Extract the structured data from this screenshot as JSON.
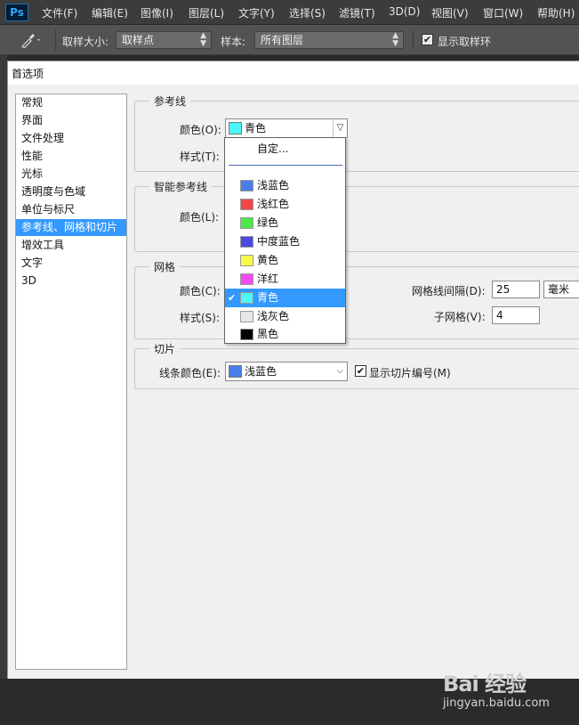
{
  "menubar": {
    "logo": "Ps",
    "items": [
      "文件(F)",
      "编辑(E)",
      "图像(I)",
      "图层(L)",
      "文字(Y)",
      "选择(S)",
      "滤镜(T)",
      "3D(D)",
      "视图(V)",
      "窗口(W)",
      "帮助(H)"
    ]
  },
  "optionsbar": {
    "sample_size_label": "取样大小:",
    "sample_size_value": "取样点",
    "sample_label": "样本:",
    "sample_value": "所有图层",
    "show_ring_label": "显示取样环",
    "show_ring_checked": true
  },
  "dialog": {
    "title": "首选项",
    "categories": [
      "常规",
      "界面",
      "文件处理",
      "性能",
      "光标",
      "透明度与色域",
      "单位与标尺",
      "参考线、网格和切片",
      "增效工具",
      "文字",
      "3D"
    ],
    "selected_category": "参考线、网格和切片",
    "guides": {
      "legend": "参考线",
      "color_label": "颜色(O):",
      "color_value": "青色",
      "color_swatch": "#4cf6f6",
      "style_label": "样式(T):"
    },
    "smart_guides": {
      "legend": "智能参考线",
      "color_label": "颜色(L):"
    },
    "grid": {
      "legend": "网格",
      "color_label": "颜色(C):",
      "style_label": "样式(S):",
      "gridline_every_label": "网格线间隔(D):",
      "gridline_every_value": "25",
      "unit_value": "毫米",
      "subdivisions_label": "子网格(V):",
      "subdivisions_value": "4"
    },
    "slices": {
      "legend": "切片",
      "line_color_label": "线条颜色(E):",
      "line_color_value": "浅蓝色",
      "line_color_swatch": "#4a7ee8",
      "show_numbers_label": "显示切片编号(M)",
      "show_numbers_checked": true
    }
  },
  "dropdown": {
    "custom_label": "自定...",
    "items": [
      {
        "label": "浅蓝色",
        "color": "#4a7ee8"
      },
      {
        "label": "浅红色",
        "color": "#f04848"
      },
      {
        "label": "绿色",
        "color": "#4ce84c"
      },
      {
        "label": "中度蓝色",
        "color": "#4a4ae0"
      },
      {
        "label": "黄色",
        "color": "#f8f84a"
      },
      {
        "label": "洋红",
        "color": "#f04cf0"
      },
      {
        "label": "青色",
        "color": "#4cf6f6"
      },
      {
        "label": "浅灰色",
        "color": "#e6e6e6"
      },
      {
        "label": "黑色",
        "color": "#000000"
      }
    ],
    "selected": "青色",
    "tick": "✔"
  },
  "watermark": {
    "logo": "Bai 经验",
    "url": "jingyan.baidu.com"
  }
}
